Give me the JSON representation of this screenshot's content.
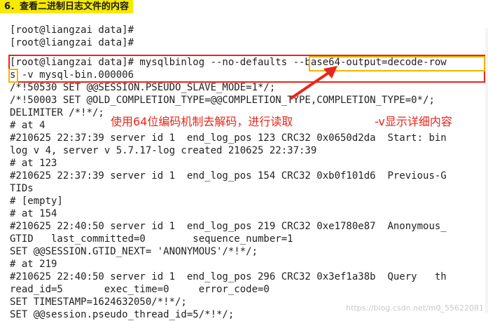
{
  "heading": "6．查看二进制日志文件的内容",
  "terminal": {
    "lines": [
      "[root@liangzai data]#",
      "[root@liangzai data]#",
      "[root@liangzai data]# mysqlbinlog --no-defaults --base64-output=decode-row",
      "s -v mysql-bin.000006",
      "/*!50530 SET @@SESSION.PSEUDO_SLAVE_MODE=1*/;",
      "/*!50003 SET @OLD_COMPLETION_TYPE=@@COMPLETION_TYPE,COMPLETION_TYPE=0*/;",
      "DELIMITER /*!*/;",
      "# at 4",
      "#210625 22:37:39 server id 1  end_log_pos 123 CRC32 0x0650d2da  Start: bin",
      "log v 4, server v 5.7.17-log created 210625 22:37:39",
      "# at 123",
      "#210625 22:37:39 server id 1  end_log_pos 154 CRC32 0xb0f101d6  Previous-G",
      "TIDs",
      "# [empty]",
      "# at 154",
      "#210625 22:40:50 server id 1  end_log_pos 219 CRC32 0xe1780e87  Anonymous_",
      "GTID   last_committed=0        sequence_number=1",
      "SET @@SESSION.GTID_NEXT= 'ANONYMOUS'/*!*/;",
      "# at 219",
      "#210625 22:40:50 server id 1  end_log_pos 296 CRC32 0x3ef1a38b  Query   th",
      "read_id=5       exec_time=0     error_code=0",
      "SET TIMESTAMP=1624632050/*!*/;",
      "SET @@session.pseudo_thread_id=5/*!*/;"
    ]
  },
  "annotations": {
    "base64": "使用64位编码机制去解码，进行读取",
    "verbose": "-v显示详细内容"
  },
  "watermark": "https://blog.csdn.net/m0_55622081",
  "colors": {
    "highlight": "#f5ea00",
    "red_box": "#e8261a",
    "yellow_box": "#f2b400"
  }
}
